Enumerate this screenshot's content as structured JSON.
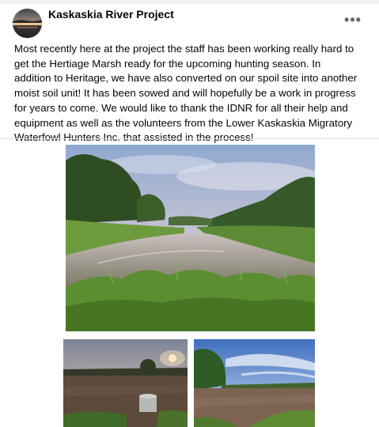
{
  "post": {
    "author": "Kaskaskia River Project",
    "avatar_icon": "river-sunset-avatar-icon",
    "more_icon": "more-options-icon",
    "more_label": "•••",
    "text": "Most recently here at the project the staff has been working really hard to\nget the Hertiage Marsh ready for the upcoming hunting season. In\naddition to Heritage, we have also converted on our spoil site into another\nmoist soil unit! It has been sowed and will hopefully be a work in progress\nfor years to come. We would like to thank the IDNR for all their help and\nequipment as well as the volunteers from the Lower Kaskaskia Migratory\nWaterfowl Hunters Inc. that assisted in the process!"
  },
  "colors": {
    "text": "#050505",
    "secondary": "#65676b",
    "divider": "#dddfe2"
  }
}
